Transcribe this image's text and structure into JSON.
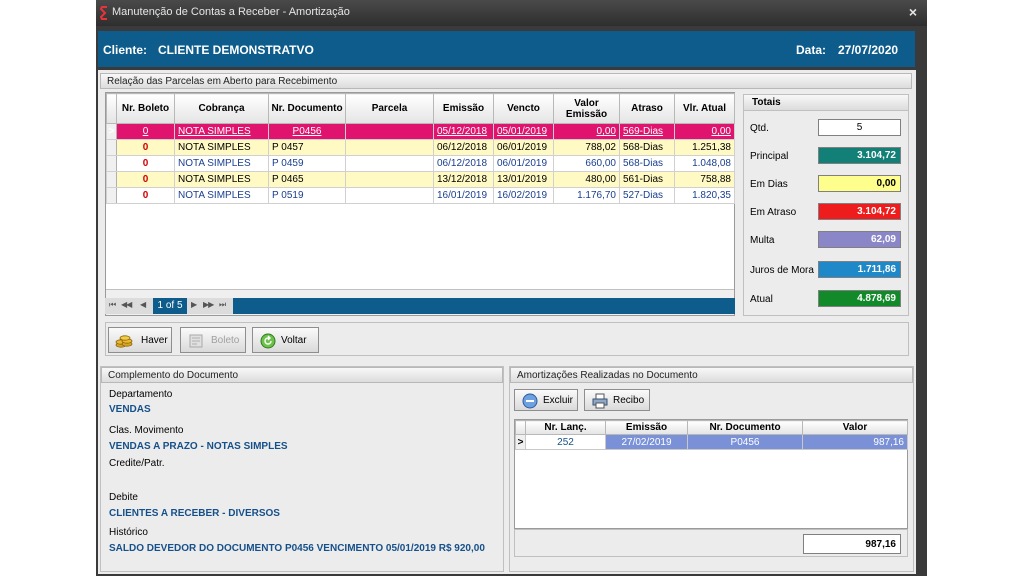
{
  "window": {
    "title": "Manutenção de Contas a Receber - Amortização",
    "close_glyph": "×"
  },
  "header": {
    "client_label": "Cliente:",
    "client_name": "CLIENTE DEMONSTRATVO",
    "date_label": "Data:",
    "date_value": "27/07/2020",
    "color": "#0e5c8c"
  },
  "parcelas": {
    "title": "Relação das Parcelas em Aberto para Recebimento",
    "columns": [
      "Nr. Boleto",
      "Cobrança",
      "Nr. Documento",
      "Parcela",
      "Emissão",
      "Vencto",
      "Valor Emissão",
      "Atraso",
      "Vlr. Atual"
    ],
    "rows": [
      {
        "indicator": ">",
        "nr_boleto": "0",
        "cobranca": "NOTA SIMPLES",
        "nr_documento": "P0456",
        "parcela": "",
        "emissao": "05/12/2018",
        "vencto": "05/01/2019",
        "valor_emissao": "0,00",
        "atraso": "569-Dias",
        "vlr_atual": "0,00"
      },
      {
        "indicator": "",
        "nr_boleto": "0",
        "cobranca": "NOTA SIMPLES",
        "nr_documento": "P 0457",
        "parcela": "",
        "emissao": "06/12/2018",
        "vencto": "06/01/2019",
        "valor_emissao": "788,02",
        "atraso": "568-Dias",
        "vlr_atual": "1.251,38"
      },
      {
        "indicator": "",
        "nr_boleto": "0",
        "cobranca": "NOTA SIMPLES",
        "nr_documento": "P 0459",
        "parcela": "",
        "emissao": "06/12/2018",
        "vencto": "06/01/2019",
        "valor_emissao": "660,00",
        "atraso": "568-Dias",
        "vlr_atual": "1.048,08"
      },
      {
        "indicator": "",
        "nr_boleto": "0",
        "cobranca": "NOTA SIMPLES",
        "nr_documento": "P 0465",
        "parcela": "",
        "emissao": "13/12/2018",
        "vencto": "13/01/2019",
        "valor_emissao": "480,00",
        "atraso": "561-Dias",
        "vlr_atual": "758,88"
      },
      {
        "indicator": "",
        "nr_boleto": "0",
        "cobranca": "NOTA SIMPLES",
        "nr_documento": "P 0519",
        "parcela": "",
        "emissao": "16/01/2019",
        "vencto": "16/02/2019",
        "valor_emissao": "1.176,70",
        "atraso": "527-Dias",
        "vlr_atual": "1.820,35"
      }
    ],
    "pagination": {
      "first": "⏮",
      "prev_page": "◀◀",
      "prev": "◀",
      "page": "1 of 5",
      "next": "▶",
      "next_page": "▶▶",
      "last": "⏭"
    }
  },
  "totals": {
    "title": "Totais",
    "items": [
      {
        "label": "Qtd.",
        "value": "5",
        "color": "#ffffff",
        "text_color": "#000000"
      },
      {
        "label": "Principal",
        "value": "3.104,72",
        "color": "#138078",
        "text_color": "#ffffff"
      },
      {
        "label": "Em Dias",
        "value": "0,00",
        "color": "#fefe8c",
        "text_color": "#000000"
      },
      {
        "label": "Em Atraso",
        "value": "3.104,72",
        "color": "#ee1c1c",
        "text_color": "#ffffff"
      },
      {
        "label": "Multa",
        "value": "62,09",
        "color": "#8a86c8",
        "text_color": "#ffffff"
      },
      {
        "label": "Juros de Mora",
        "value": "1.711,86",
        "color": "#1e88c8",
        "text_color": "#ffffff"
      },
      {
        "label": "Atual",
        "value": "4.878,69",
        "color": "#138a2a",
        "text_color": "#ffffff"
      }
    ]
  },
  "buttons": {
    "haver": "Haver",
    "boleto": "Boleto",
    "voltar": "Voltar"
  },
  "complemento": {
    "title": "Complemento do Documento",
    "departamento_label": "Departamento",
    "departamento_value": "VENDAS",
    "clas_label": "Clas. Movimento",
    "clas_value": "VENDAS A PRAZO - NOTAS SIMPLES",
    "credito_label": "Credite/Patr.",
    "credito_value": "",
    "debito_label": "Debite",
    "debito_value": "CLIENTES A RECEBER - DIVERSOS",
    "historico_label": "Histórico",
    "historico_value": "SALDO DEVEDOR DO DOCUMENTO P0456 VENCIMENTO 05/01/2019 R$ 920,00"
  },
  "amortizacoes": {
    "title": "Amortizações Realizadas no Documento",
    "excluir": "Excluir",
    "recibo": "Recibo",
    "columns": [
      "Nr. Lanç.",
      "Emissão",
      "Nr. Documento",
      "Valor"
    ],
    "rows": [
      {
        "indicator": ">",
        "nr_lanc": "252",
        "emissao": "27/02/2019",
        "nr_documento": "P0456",
        "valor": "987,16"
      }
    ],
    "total": "987,16"
  }
}
